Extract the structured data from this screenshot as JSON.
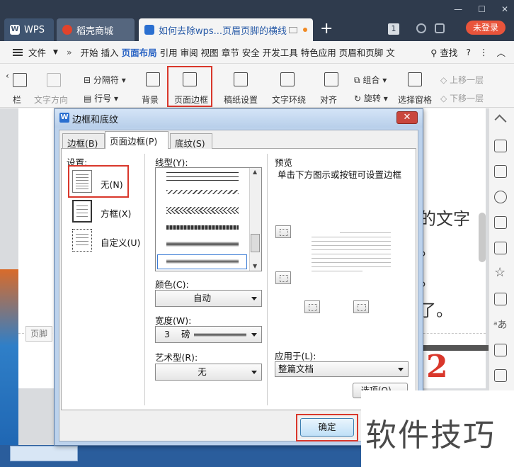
{
  "app": {
    "tabs": [
      {
        "label": "WPS"
      },
      {
        "label": "稻壳商城"
      },
      {
        "label": "如何去除wps...页眉页脚的横线"
      }
    ],
    "new_tab_symbol": "+",
    "window_controls": [
      "—",
      "☐",
      "✕"
    ],
    "page_count_badge": "1",
    "login_label": "未登录"
  },
  "menubar": {
    "file_label": "文件",
    "more_left": "»",
    "items": [
      "开始",
      "插入",
      "页面布局",
      "引用",
      "审阅",
      "视图",
      "章节",
      "安全",
      "开发工具",
      "特色应用",
      "页眉和页脚",
      "文"
    ],
    "active_item": "页面布局",
    "search_label": "查找",
    "help_symbol": "?",
    "more_symbol": "⋮",
    "collapse_symbol": "︿"
  },
  "ribbon": {
    "left_label": "栏",
    "text_direction": "文字方向",
    "separator": "分隔符",
    "line_number": "行号",
    "background": "背景",
    "page_border": "页面边框",
    "manuscript": "稿纸设置",
    "text_wrap": "文字环绕",
    "align": "对齐",
    "group": "组合",
    "rotate": "旋转",
    "selection_pane": "选择窗格",
    "bring_forward": "上移一层",
    "send_backward": "下移一层"
  },
  "document": {
    "text_lines": [
      "的文字",
      "。",
      "。",
      "了。"
    ],
    "footer_label": "页脚",
    "step_number": "2"
  },
  "dialog": {
    "title": "边框和底纹",
    "close_symbol": "✕",
    "tabs": [
      {
        "label": "边框(B)"
      },
      {
        "label": "页面边框(P)"
      },
      {
        "label": "底纹(S)"
      }
    ],
    "settings_label": "设置:",
    "settings": [
      {
        "label": "无(N)"
      },
      {
        "label": "方框(X)"
      },
      {
        "label": "自定义(U)"
      }
    ],
    "line_style_label": "线型(Y):",
    "color_label": "颜色(C):",
    "color_value": "自动",
    "width_label": "宽度(W):",
    "width_value": "3",
    "width_unit": "磅",
    "art_label": "艺术型(R):",
    "art_value": "无",
    "preview_label": "预览",
    "preview_hint": "单击下方图示或按钮可设置边框",
    "apply_to_label": "应用于(L):",
    "apply_to_value": "整篇文档",
    "options_button": "选项(O)...",
    "ok_button": "确定"
  },
  "watermark": "软件技巧",
  "colors": {
    "accent_red": "#d9372b",
    "active_blue": "#2a64c4",
    "title_bar": "#2f3b4d",
    "login_orange": "#e9543b"
  }
}
